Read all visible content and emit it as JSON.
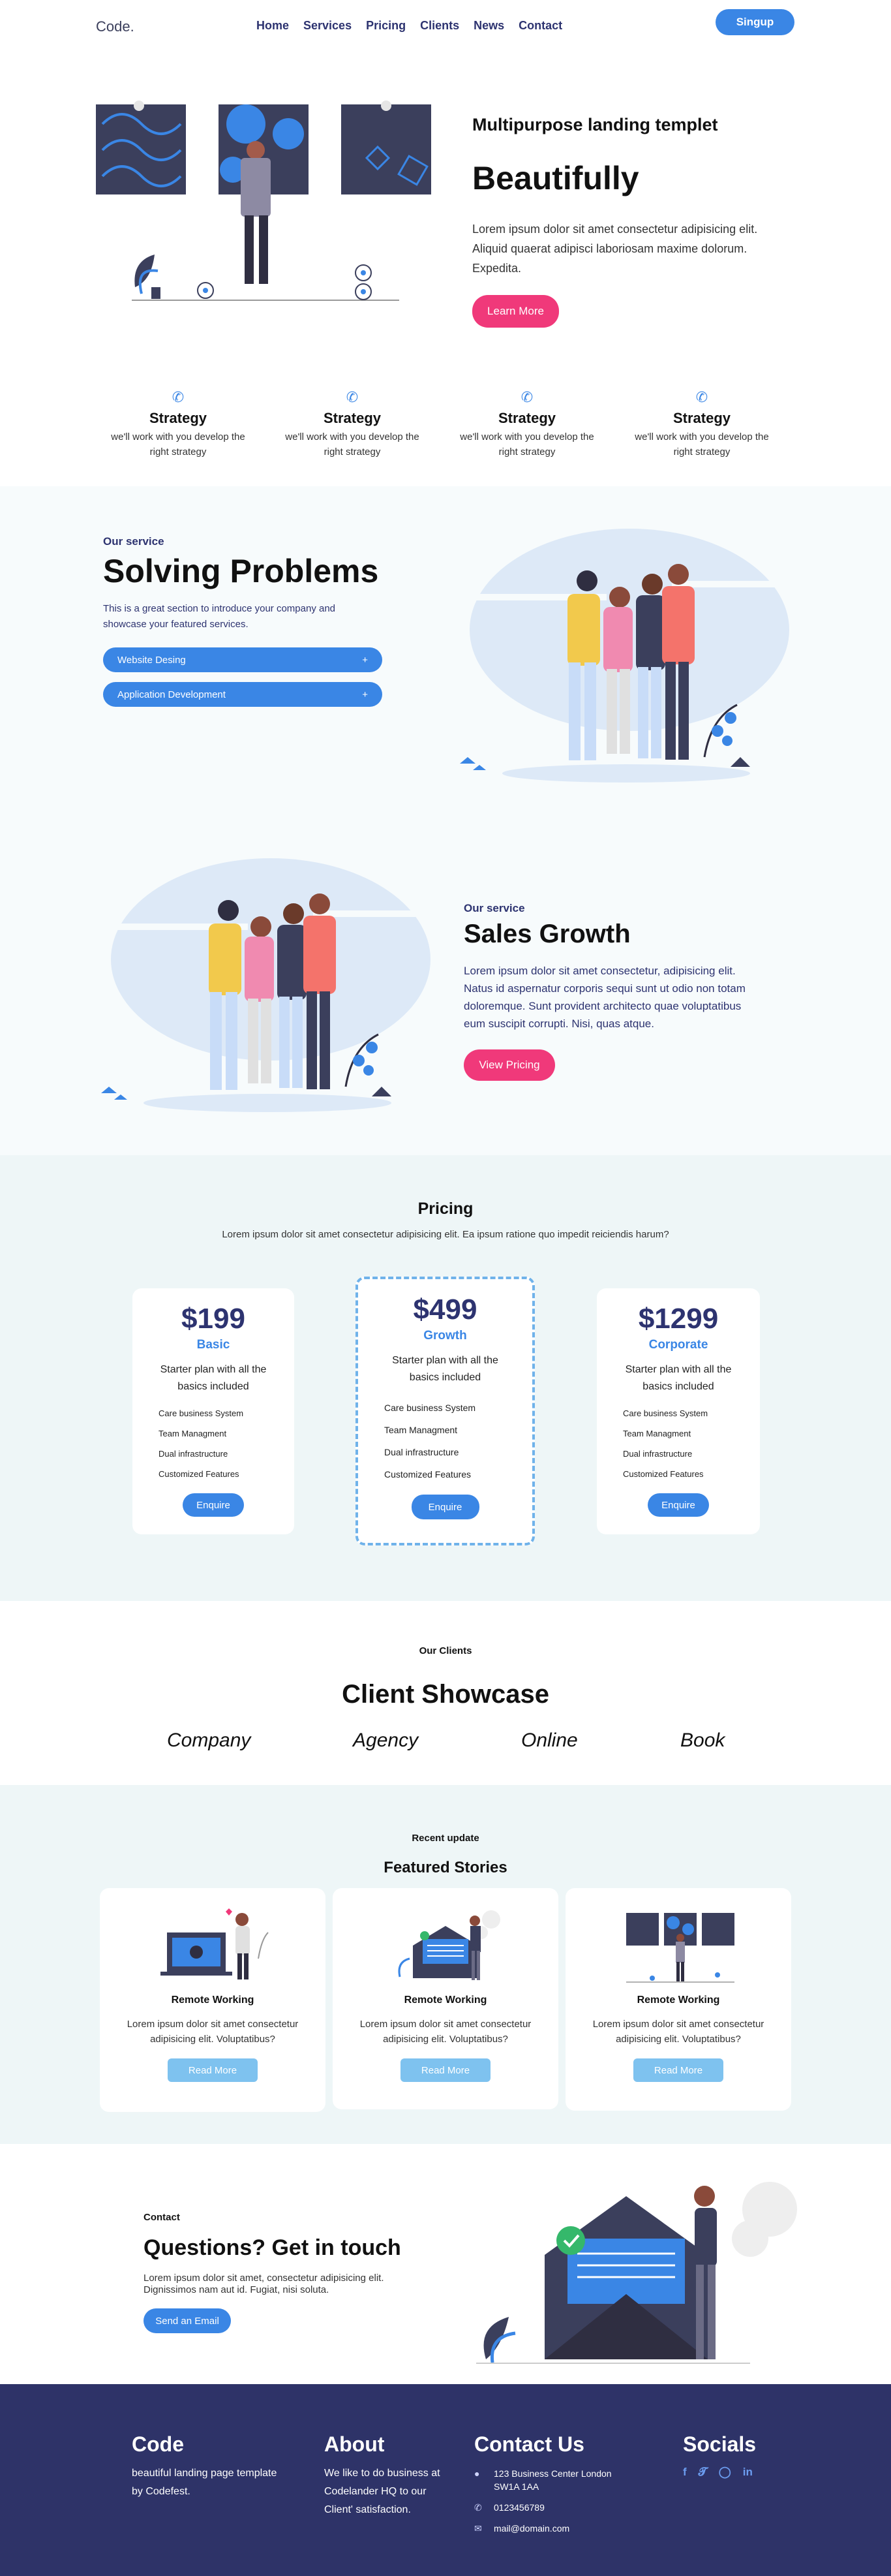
{
  "nav": {
    "logo": "Code.",
    "menu": [
      "Home",
      "Services",
      "Pricing",
      "Clients",
      "News",
      "Contact"
    ],
    "signup": "Singup"
  },
  "hero": {
    "subtitle": "Multipurpose landing templet",
    "title": "Beautifully",
    "text": "Lorem ipsum dolor sit amet consectetur adipisicing elit. Aliquid quaerat adipisci laboriosam maxime dolorum. Expedita.",
    "button": "Learn More"
  },
  "features": [
    {
      "icon": "phone-icon",
      "title": "Strategy",
      "text": "we'll work with you develop the right strategy"
    },
    {
      "icon": "phone-icon",
      "title": "Strategy",
      "text": "we'll work with you develop the right strategy"
    },
    {
      "icon": "phone-icon",
      "title": "Strategy",
      "text": "we'll work with you develop the right strategy"
    },
    {
      "icon": "phone-icon",
      "title": "Strategy",
      "text": "we'll work with you develop the right strategy"
    }
  ],
  "service1": {
    "tag": "Our service",
    "title": "Solving Problems",
    "text": "This is a great section to introduce your company and showcase your featured services.",
    "accordion": [
      {
        "label": "Website Desing",
        "icon": "+"
      },
      {
        "label": "Application Development",
        "icon": "+"
      }
    ]
  },
  "service2": {
    "tag": "Our service",
    "title": "Sales Growth",
    "text": "Lorem ipsum dolor sit amet consectetur, adipisicing elit. Natus id aspernatur corporis sequi sunt ut odio non totam doloremque. Sunt provident architecto quae voluptatibus eum suscipit corrupti. Nisi, quas atque.",
    "button": "View Pricing"
  },
  "pricing": {
    "title": "Pricing",
    "subtitle": "Lorem ipsum dolor sit amet consectetur adipisicing elit. Ea ipsum ratione quo impedit reiciendis harum?",
    "plans": [
      {
        "amount": "$199",
        "name": "Basic",
        "desc": "Starter plan with all the basics included",
        "features": [
          "Care business System",
          "Team Managment",
          "Dual infrastructure",
          "Customized Features"
        ],
        "button": "Enquire"
      },
      {
        "amount": "$499",
        "name": "Growth",
        "desc": "Starter plan with all the basics included",
        "features": [
          "Care business System",
          "Team Managment",
          "Dual infrastructure",
          "Customized Features"
        ],
        "button": "Enquire"
      },
      {
        "amount": "$1299",
        "name": "Corporate",
        "desc": "Starter plan with all the basics included",
        "features": [
          "Care business System",
          "Team Managment",
          "Dual infrastructure",
          "Customized Features"
        ],
        "button": "Enquire"
      }
    ]
  },
  "clients": {
    "tag": "Our Clients",
    "title": "Client Showcase",
    "logos": [
      "Company",
      "Agency",
      "Online",
      "Book"
    ]
  },
  "stories": {
    "tag": "Recent update",
    "title": "Featured Stories",
    "items": [
      {
        "title": "Remote Working",
        "text": "Lorem ipsum dolor sit amet consectetur adipisicing elit. Voluptatibus?",
        "button": "Read More"
      },
      {
        "title": "Remote Working",
        "text": "Lorem ipsum dolor sit amet consectetur adipisicing elit. Voluptatibus?",
        "button": "Read More"
      },
      {
        "title": "Remote Working",
        "text": "Lorem ipsum dolor sit amet consectetur adipisicing elit. Voluptatibus?",
        "button": "Read More"
      }
    ]
  },
  "contact": {
    "tag": "Contact",
    "title": "Questions? Get in touch",
    "text": "Lorem ipsum dolor sit amet, consectetur adipisicing elit. Dignissimos nam aut id. Fugiat, nisi soluta.",
    "button": "Send an Email"
  },
  "footer": {
    "brand": {
      "title": "Code",
      "text": "beautiful landing page template by Codefest."
    },
    "about": {
      "title": "About",
      "text": "We like to do business at Codelander HQ to our Client' satisfaction."
    },
    "contact": {
      "title": "Contact Us",
      "address": "123 Business Center London SW1A 1AA",
      "phone": "0123456789",
      "email": "mail@domain.com"
    },
    "socials": {
      "title": "Socials",
      "icons": [
        "facebook-icon",
        "twitter-icon",
        "instagram-icon",
        "linkedin-icon"
      ]
    }
  },
  "colors": {
    "accent": "#3a86e5",
    "pink": "#f0397a",
    "navy": "#2e3368",
    "band": "#eef6f7"
  }
}
